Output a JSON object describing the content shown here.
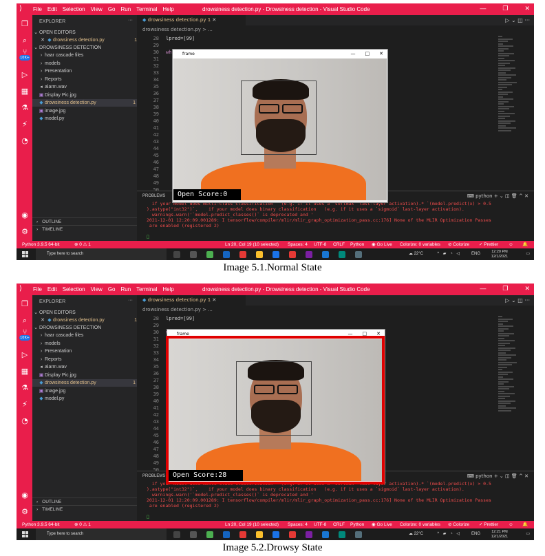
{
  "screens": [
    {
      "titlebar": {
        "menu": [
          "File",
          "Edit",
          "Selection",
          "View",
          "Go",
          "Run",
          "Terminal",
          "Help"
        ],
        "title": "drowsiness detection.py - Drowsiness detection - Visual Studio Code"
      },
      "explorer": {
        "header": "EXPLORER",
        "open_editors": "OPEN EDITORS",
        "open_file": "drowsiness detection.py",
        "open_file_count": "1",
        "project": "DROWSINESS DETECTION",
        "items": [
          "haar cascade files",
          "models",
          "Presentation",
          "Reports",
          "alarm.wav",
          "Display Pic.jpg",
          "drowsiness detection.py",
          "image.jpg",
          "model.py"
        ],
        "outline": "OUTLINE",
        "timeline": "TIMELINE"
      },
      "editor": {
        "tab": "drowsiness detection.py 1",
        "breadcrumb": "drowsiness detection.py > ...",
        "lines": [
          {
            "n": "28",
            "t": "lpred=[99]"
          },
          {
            "n": "29",
            "t": ""
          },
          {
            "n": "30",
            "t": "wh"
          },
          {
            "n": "31",
            "t": ""
          },
          {
            "n": "32",
            "t": ""
          },
          {
            "n": "33",
            "t": ""
          },
          {
            "n": "34",
            "t": ""
          },
          {
            "n": "35",
            "t": ""
          },
          {
            "n": "36",
            "t": "                                          inSize=(25,25))"
          },
          {
            "n": "37",
            "t": ""
          },
          {
            "n": "38",
            "t": ""
          },
          {
            "n": "39",
            "t": ""
          },
          {
            "n": "40",
            "t": "                                          hess=cv2.FILLED )"
          },
          {
            "n": "41",
            "t": ""
          },
          {
            "n": "42",
            "t": ""
          },
          {
            "n": "43",
            "t": ""
          },
          {
            "n": "44",
            "t": ""
          },
          {
            "n": "45",
            "t": ""
          },
          {
            "n": "46",
            "t": ""
          },
          {
            "n": "47",
            "t": ""
          },
          {
            "n": "48",
            "t": ""
          },
          {
            "n": "49",
            "t": ""
          },
          {
            "n": "50",
            "t": ""
          }
        ]
      },
      "frame": {
        "title": "frame",
        "overlay": "Open   Score:0",
        "alarm": false
      },
      "panel": {
        "tab": "PROBLEMS",
        "shell": "python",
        "terminal": [
          "  if your model does multi-class classification   (e.g. if it uses a `softmax` last-layer activation).* `(model.predict(x) > 0.5",
          ").astype(\"int32\")`,    if your model does binary classification   (e.g. if it uses a `sigmoid` last-layer activation).",
          "  warnings.warn('`model.predict_classes()` is deprecated and '",
          "2021-12-01 12:20:09.001289: I tensorflow/compiler/mlir/mlir_graph_optimization_pass.cc:176] None of the MLIR Optimization Passes",
          " are enabled (registered 2)"
        ]
      },
      "status": {
        "python": "Python 3.9.5 64-bit",
        "problems": "⊗ 0 ⚠ 1",
        "position": "Ln 20, Col 19 (10 selected)",
        "spaces": "Spaces: 4",
        "encoding": "UTF-8",
        "eol": "CRLF",
        "language": "Python",
        "golive": "◉ Go Live",
        "colorize_vars": "Colorize: 0 variables",
        "colorize": "⊘ Colorize",
        "prettier": "✓ Prettier"
      },
      "taskbar": {
        "search": "Type here to search",
        "weather": "22°C",
        "lang": "ENG",
        "time": "12:20 PM",
        "date": "12/1/2021"
      },
      "caption": "Image 5.1.Normal State"
    },
    {
      "titlebar": {
        "menu": [
          "File",
          "Edit",
          "Selection",
          "View",
          "Go",
          "Run",
          "Terminal",
          "Help"
        ],
        "title": "drowsiness detection.py - Drowsiness detection - Visual Studio Code"
      },
      "explorer": {
        "header": "EXPLORER",
        "open_editors": "OPEN EDITORS",
        "open_file": "drowsiness detection.py",
        "open_file_count": "1",
        "project": "DROWSINESS DETECTION",
        "items": [
          "haar cascade files",
          "models",
          "Presentation",
          "Reports",
          "alarm.wav",
          "Display Pic.jpg",
          "drowsiness detection.py",
          "image.jpg",
          "model.py"
        ],
        "outline": "OUTLINE",
        "timeline": "TIMELINE"
      },
      "editor": {
        "tab": "drowsiness detection.py 1",
        "breadcrumb": "drowsiness detection.py > ...",
        "lines": [
          {
            "n": "28",
            "t": "lpred=[99]"
          },
          {
            "n": "29",
            "t": ""
          },
          {
            "n": "30",
            "t": "wh"
          },
          {
            "n": "31",
            "t": ""
          },
          {
            "n": "32",
            "t": ""
          },
          {
            "n": "33",
            "t": ""
          },
          {
            "n": "34",
            "t": ""
          },
          {
            "n": "35",
            "t": ""
          },
          {
            "n": "36",
            "t": "                                          inSize=(25,25))"
          },
          {
            "n": "37",
            "t": ""
          },
          {
            "n": "38",
            "t": ""
          },
          {
            "n": "39",
            "t": ""
          },
          {
            "n": "40",
            "t": "                                          hess=cv2.FILLED )"
          },
          {
            "n": "41",
            "t": ""
          },
          {
            "n": "42",
            "t": ""
          },
          {
            "n": "43",
            "t": ""
          },
          {
            "n": "44",
            "t": ""
          },
          {
            "n": "45",
            "t": ""
          },
          {
            "n": "46",
            "t": ""
          },
          {
            "n": "47",
            "t": ""
          },
          {
            "n": "48",
            "t": ""
          },
          {
            "n": "49",
            "t": ""
          },
          {
            "n": "50",
            "t": ""
          }
        ]
      },
      "frame": {
        "title": "frame",
        "overlay": "Open   Score:28",
        "alarm": true
      },
      "panel": {
        "tab": "PROBLEMS",
        "shell": "python",
        "terminal": [
          "  if your model does multi-class classification   (e.g. if it uses a `softmax` last-layer activation).* `(model.predict(x) > 0.5",
          ").astype(\"int32\")`,    if your model does binary classification   (e.g. if it uses a `sigmoid` last-layer activation).",
          "  warnings.warn('`model.predict_classes()` is deprecated and '",
          "2021-12-01 12:20:09.001289: I tensorflow/compiler/mlir/mlir_graph_optimization_pass.cc:176] None of the MLIR Optimization Passes",
          " are enabled (registered 2)"
        ]
      },
      "status": {
        "python": "Python 3.9.5 64-bit",
        "problems": "⊗ 0 ⚠ 1",
        "position": "Ln 20, Col 19 (10 selected)",
        "spaces": "Spaces: 4",
        "encoding": "UTF-8",
        "eol": "CRLF",
        "language": "Python",
        "golive": "◉ Go Live",
        "colorize_vars": "Colorize: 0 variables",
        "colorize": "⊘ Colorize",
        "prettier": "✓ Prettier"
      },
      "taskbar": {
        "search": "Type here to search",
        "weather": "22°C",
        "lang": "ENG",
        "time": "12:21 PM",
        "date": "12/1/2021"
      },
      "caption": "Image 5.2.Drowsy State"
    }
  ],
  "colors": {
    "accent": "#e91e4b",
    "alarm_border": "#e00000",
    "terminal_error": "#f14c4c"
  }
}
